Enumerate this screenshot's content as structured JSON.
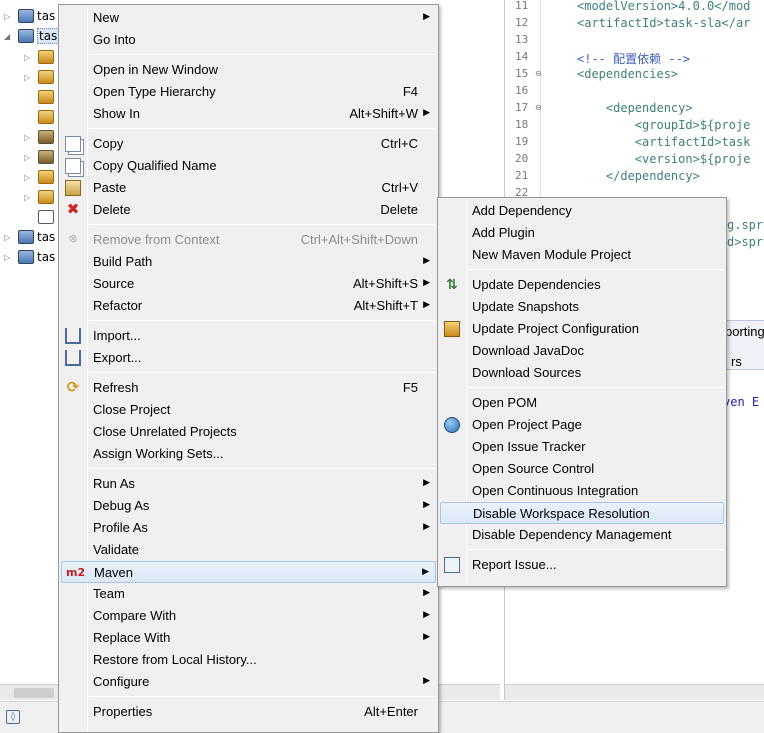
{
  "explorer": {
    "rows": [
      {
        "label": "tas",
        "kind": "project",
        "twisty": "▷"
      },
      {
        "label": "tas",
        "kind": "project",
        "twisty": "◢",
        "selected": true
      },
      {
        "label": "",
        "kind": "package",
        "twisty": "▷"
      },
      {
        "label": "",
        "kind": "package",
        "twisty": "▷"
      },
      {
        "label": "",
        "kind": "package",
        "twisty": ""
      },
      {
        "label": "",
        "kind": "package",
        "twisty": ""
      },
      {
        "label": "",
        "kind": "library",
        "twisty": "▷"
      },
      {
        "label": "",
        "kind": "library",
        "twisty": "▷"
      },
      {
        "label": "",
        "kind": "package",
        "twisty": "▷"
      },
      {
        "label": "",
        "kind": "package",
        "twisty": "▷"
      },
      {
        "label": "",
        "kind": "xml",
        "twisty": ""
      },
      {
        "label": "tas",
        "kind": "project",
        "twisty": "▷"
      },
      {
        "label": "tas",
        "kind": "project",
        "twisty": "▷"
      }
    ]
  },
  "editor": {
    "lines": [
      {
        "num": "11",
        "text": "<modelVersion>4.0.0</mod",
        "kind": "tag"
      },
      {
        "num": "12",
        "text": "<artifactId>task-sla</ar",
        "kind": "tag"
      },
      {
        "num": "13",
        "text": "",
        "kind": "tag"
      },
      {
        "num": "14",
        "text": "<!-- 配置依赖 -->",
        "kind": "comment"
      },
      {
        "num": "15",
        "text": "<dependencies>",
        "kind": "tag",
        "fold": "⊖"
      },
      {
        "num": "16",
        "text": "",
        "kind": "tag"
      },
      {
        "num": "17",
        "text": "    <dependency>",
        "kind": "tag",
        "fold": "⊖"
      },
      {
        "num": "18",
        "text": "        <groupId>${proje",
        "kind": "tag"
      },
      {
        "num": "19",
        "text": "        <artifactId>task",
        "kind": "tag"
      },
      {
        "num": "20",
        "text": "        <version>${proje",
        "kind": "tag"
      },
      {
        "num": "21",
        "text": "    </dependency>",
        "kind": "tag"
      },
      {
        "num": "22",
        "text": "",
        "kind": "tag"
      }
    ],
    "partial_fragments": [
      "g.spr",
      "d>spr"
    ],
    "lower_tabs": [
      "porting",
      "rs"
    ],
    "lower_text": "ven E"
  },
  "context_menu": {
    "items": [
      {
        "label": "New",
        "submenu": true
      },
      {
        "label": "Go Into"
      },
      {
        "sep": true
      },
      {
        "label": "Open in New Window"
      },
      {
        "label": "Open Type Hierarchy",
        "accel": "F4"
      },
      {
        "label": "Show In",
        "accel": "Alt+Shift+W",
        "submenu": true
      },
      {
        "sep": true
      },
      {
        "label": "Copy",
        "accel": "Ctrl+C",
        "icon": "copy-icon"
      },
      {
        "label": "Copy Qualified Name",
        "icon": "copy-qualified-name-icon"
      },
      {
        "label": "Paste",
        "accel": "Ctrl+V",
        "icon": "paste-icon"
      },
      {
        "label": "Delete",
        "accel": "Delete",
        "icon": "delete-icon"
      },
      {
        "sep": true
      },
      {
        "label": "Remove from Context",
        "accel": "Ctrl+Alt+Shift+Down",
        "disabled": true,
        "icon": "remove-context-icon"
      },
      {
        "label": "Build Path",
        "submenu": true
      },
      {
        "label": "Source",
        "accel": "Alt+Shift+S",
        "submenu": true
      },
      {
        "label": "Refactor",
        "accel": "Alt+Shift+T",
        "submenu": true
      },
      {
        "sep": true
      },
      {
        "label": "Import...",
        "icon": "import-icon"
      },
      {
        "label": "Export...",
        "icon": "export-icon"
      },
      {
        "sep": true
      },
      {
        "label": "Refresh",
        "accel": "F5",
        "icon": "refresh-icon"
      },
      {
        "label": "Close Project"
      },
      {
        "label": "Close Unrelated Projects"
      },
      {
        "label": "Assign Working Sets..."
      },
      {
        "sep": true
      },
      {
        "label": "Run As",
        "submenu": true
      },
      {
        "label": "Debug As",
        "submenu": true
      },
      {
        "label": "Profile As",
        "submenu": true
      },
      {
        "label": "Validate"
      },
      {
        "label": "Maven",
        "submenu": true,
        "highlighted": true,
        "icon": "maven-m2-icon"
      },
      {
        "label": "Team",
        "submenu": true
      },
      {
        "label": "Compare With",
        "submenu": true
      },
      {
        "label": "Replace With",
        "submenu": true
      },
      {
        "label": "Restore from Local History..."
      },
      {
        "label": "Configure",
        "submenu": true
      },
      {
        "sep": true
      },
      {
        "label": "Properties",
        "accel": "Alt+Enter"
      }
    ]
  },
  "maven_submenu": {
    "items": [
      {
        "label": "Add Dependency"
      },
      {
        "label": "Add Plugin"
      },
      {
        "label": "New Maven Module Project"
      },
      {
        "sep": true
      },
      {
        "label": "Update Dependencies",
        "icon": "update-dependencies-icon"
      },
      {
        "label": "Update Snapshots"
      },
      {
        "label": "Update Project Configuration",
        "icon": "update-project-config-icon"
      },
      {
        "label": "Download JavaDoc"
      },
      {
        "label": "Download Sources"
      },
      {
        "sep": true
      },
      {
        "label": "Open POM"
      },
      {
        "label": "Open Project Page",
        "icon": "globe-icon"
      },
      {
        "label": "Open Issue Tracker"
      },
      {
        "label": "Open Source Control"
      },
      {
        "label": "Open Continuous Integration"
      },
      {
        "label": "Disable Workspace Resolution",
        "highlighted": true
      },
      {
        "label": "Disable Dependency Management"
      },
      {
        "sep": true
      },
      {
        "label": "Report Issue...",
        "icon": "report-issue-icon"
      }
    ]
  }
}
